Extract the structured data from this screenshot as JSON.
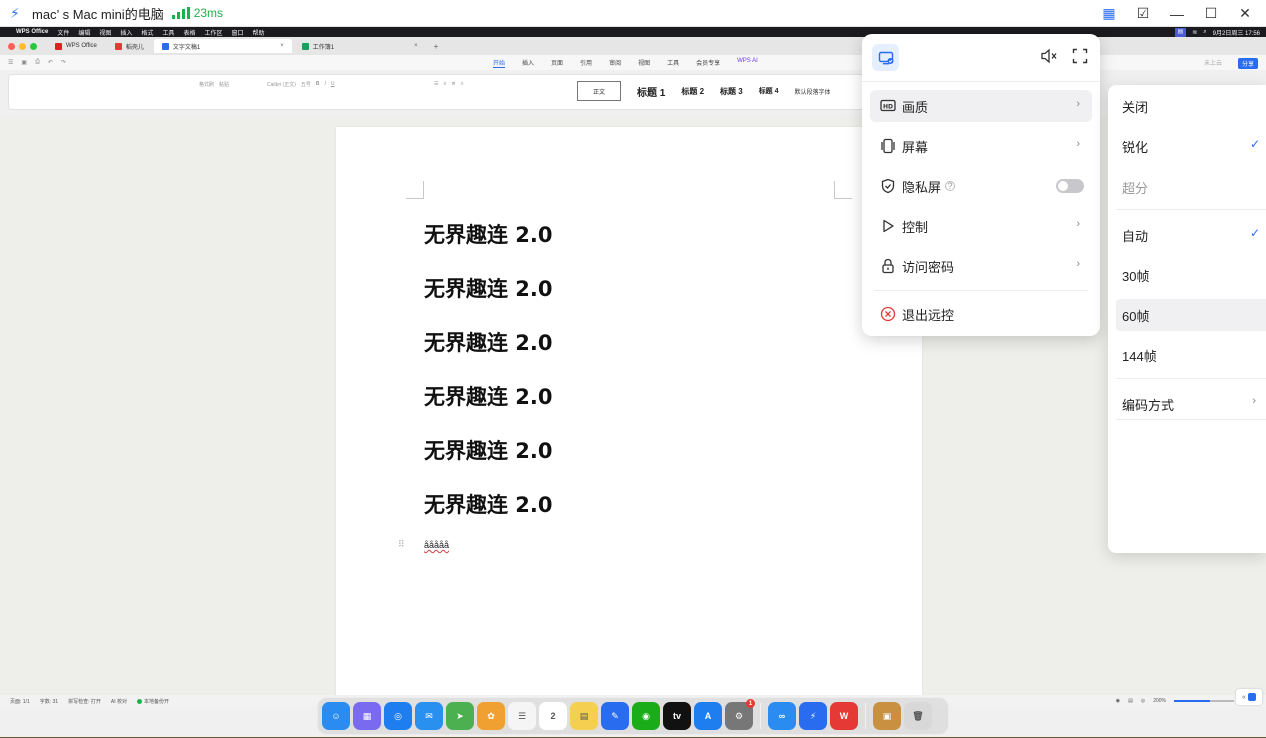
{
  "client": {
    "title": "mac’ s Mac mini的电脑",
    "latency": "23ms",
    "icons": [
      "bolt-icon",
      "signal-icon",
      "grid-icon",
      "clipboard-icon",
      "minimize-icon",
      "maximize-icon",
      "close-icon"
    ]
  },
  "mac_menubar": {
    "app": "WPS Office",
    "menus": [
      "文件",
      "编辑",
      "视图",
      "插入",
      "格式",
      "工具",
      "表格",
      "工作区",
      "窗口",
      "帮助"
    ],
    "clock": "9月2日周三 17:56"
  },
  "wps": {
    "tabs": [
      {
        "label": "WPS Office",
        "color": "#e02020"
      },
      {
        "label": "稻壳儿",
        "color": "#e53935"
      },
      {
        "label": "文字文稿1",
        "color": "#2a6cf0",
        "active": true
      },
      {
        "label": "工作簿1",
        "color": "#1aa05a"
      }
    ],
    "ribbon_tabs": [
      "开始",
      "插入",
      "页面",
      "引用",
      "审阅",
      "视图",
      "工具",
      "会员专享",
      "WPS AI"
    ],
    "active_ribbon_tab": "开始",
    "login": "未上云",
    "share": "分享",
    "login_label": "立即登录",
    "font_name": "Calibri (正文)",
    "font_size": "五号",
    "format_painter": "格式刷",
    "paste": "粘贴",
    "styles": [
      "正文",
      "标题 1",
      "标题 2",
      "标题 3",
      "标题 4",
      "默认段落字体"
    ]
  },
  "document": {
    "headings": [
      "无界趣连 2.0",
      "无界趣连 2.0",
      "无界趣连 2.0",
      "无界趣连 2.0",
      "无界趣连 2.0",
      "无界趣连 2.0"
    ],
    "small_text": "ååååå"
  },
  "statusbar": {
    "page": "页面: 1/1",
    "words": "字数: 31",
    "spellcheck": "拼写检查: 打开",
    "ai": "AI 校对",
    "backup": "本地备份开",
    "zoom": "200%",
    "zoom_level": 0.6
  },
  "dock": {
    "apps": [
      {
        "name": "finder",
        "color": "#2a8cf0",
        "glyph": "☺"
      },
      {
        "name": "launchpad",
        "color": "#7a6af0",
        "glyph": "▦"
      },
      {
        "name": "safari",
        "color": "#1e7ef0",
        "glyph": "◎"
      },
      {
        "name": "mail",
        "color": "#2a90f0",
        "glyph": "✉"
      },
      {
        "name": "maps",
        "color": "#4caf50",
        "glyph": "➤"
      },
      {
        "name": "photos",
        "color": "#f0a030",
        "glyph": "✿"
      },
      {
        "name": "reminders",
        "color": "#f5f5f5",
        "glyph": "☰"
      },
      {
        "name": "calendar",
        "color": "#ffffff",
        "glyph": "2"
      },
      {
        "name": "notes",
        "color": "#f5d050",
        "glyph": "▤"
      },
      {
        "name": "freeform",
        "color": "#2a6cf0",
        "glyph": "✎"
      },
      {
        "name": "wechat",
        "color": "#1aad19",
        "glyph": "◉"
      },
      {
        "name": "appletv",
        "color": "#111111",
        "glyph": "tv"
      },
      {
        "name": "appstore",
        "color": "#1e7ef0",
        "glyph": "A"
      },
      {
        "name": "settings",
        "color": "#777777",
        "glyph": "⚙",
        "badge": "1"
      },
      {
        "name": "baidu-netdisk",
        "color": "#2a8cf0",
        "glyph": "∞"
      },
      {
        "name": "wujie-qulian",
        "color": "#2a6cf0",
        "glyph": "⚡"
      },
      {
        "name": "wps",
        "color": "#e53935",
        "glyph": "W"
      },
      {
        "name": "downloads",
        "color": "#c89040",
        "glyph": "▣"
      },
      {
        "name": "trash",
        "color": "#d8d8d8",
        "glyph": "🗑"
      }
    ]
  },
  "panel": {
    "items": [
      {
        "label": "画质",
        "icon": "hd-icon",
        "arrow": true,
        "active": true
      },
      {
        "label": "屏幕",
        "icon": "screen-icon",
        "arrow": true
      },
      {
        "label": "隐私屏",
        "icon": "shield-icon",
        "toggle": true,
        "toggle_on": false
      },
      {
        "label": "控制",
        "icon": "play-icon",
        "arrow": true
      },
      {
        "label": "访问密码",
        "icon": "lock-icon",
        "arrow": true
      },
      {
        "label": "退出远控",
        "icon": "exit-icon"
      }
    ],
    "accent": "#2a6cf0",
    "exit_color": "#e53935"
  },
  "submenu": {
    "sharpness": [
      {
        "label": "关闭"
      },
      {
        "label": "锐化",
        "checked": true
      },
      {
        "label": "超分",
        "disabled": true
      }
    ],
    "framerate": [
      {
        "label": "自动",
        "checked": true
      },
      {
        "label": "30帧"
      },
      {
        "label": "60帧",
        "hover": true
      },
      {
        "label": "144帧"
      }
    ],
    "encoding": {
      "label": "编码方式"
    }
  }
}
